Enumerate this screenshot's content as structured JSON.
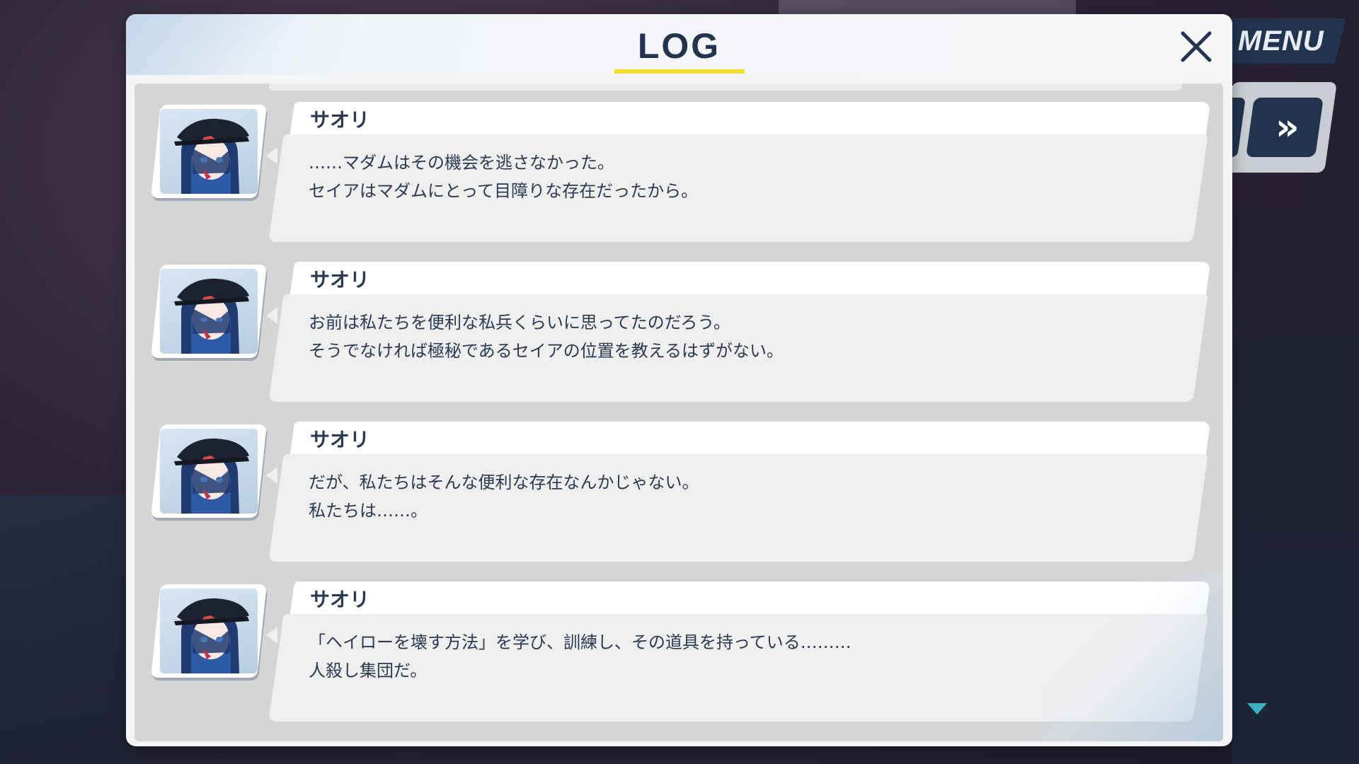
{
  "header": {
    "title": "LOG"
  },
  "menu": {
    "label": "MENU",
    "fast_forward_glyph": "»"
  },
  "colors": {
    "accent_yellow": "#f2df2c",
    "text_navy": "#2b3a52",
    "button_navy": "#22334d",
    "scroll_indicator": "#3cb1c4"
  },
  "entries": [
    {
      "speaker": "サオリ",
      "lines": [
        "……マダムはその機会を逃さなかった。",
        "セイアはマダムにとって目障りな存在だったから。"
      ]
    },
    {
      "speaker": "サオリ",
      "lines": [
        "お前は私たちを便利な私兵くらいに思ってたのだろう。",
        "そうでなければ極秘であるセイアの位置を教えるはずがない。"
      ]
    },
    {
      "speaker": "サオリ",
      "lines": [
        "だが、私たちはそんな便利な存在なんかじゃない。",
        "私たちは……。"
      ]
    },
    {
      "speaker": "サオリ",
      "lines": [
        "「ヘイローを壊す方法」を学び、訓練し、その道具を持っている………",
        "人殺し集団だ。"
      ]
    }
  ],
  "icons": {
    "close": "close-icon",
    "scroll": "scroll-down-icon",
    "fast_forward": "fast-forward-icon"
  }
}
